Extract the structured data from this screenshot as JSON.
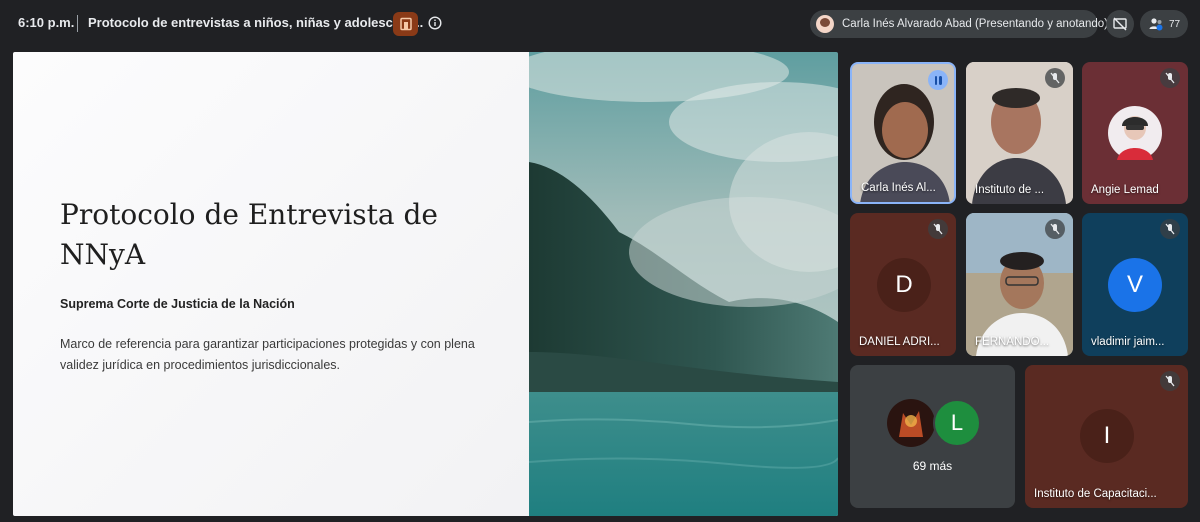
{
  "topbar": {
    "time": "6:10 p.m.",
    "meeting_title": "Protocolo de entrevistas a niños, niñas y adolescent...",
    "presenter_label": "Carla Inés Alvarado Abad (Presentando y anotando)",
    "participant_count": "77",
    "icons": {
      "host": "host-controls-icon",
      "info": "info-icon",
      "stop_presenting": "presentation-off-icon",
      "people": "people-icon"
    }
  },
  "slide": {
    "title": "Protocolo de Entrevista de NNyA",
    "organization": "Suprema Corte de Justicia de la Nación",
    "description": "Marco de referencia para garantizar participaciones protegidas y con plena validez jurídica en procedimientos jurisdiccionales."
  },
  "tiles": [
    {
      "name": "Carla Inés Al...",
      "state": "speaking"
    },
    {
      "name": "Instituto de ...",
      "state": "muted"
    },
    {
      "name": "Angie Lemad",
      "state": "muted"
    },
    {
      "name": "DANIEL ADRI...",
      "state": "muted",
      "avatar_letter": "D"
    },
    {
      "name": "FERNANDO...",
      "state": "muted"
    },
    {
      "name": "vladimir jaim...",
      "state": "muted",
      "avatar_letter": "V"
    },
    {
      "name": "69 más",
      "avatar_letter": "L"
    },
    {
      "name": "Instituto de Capacitaci...",
      "state": "muted",
      "avatar_letter": "I"
    }
  ],
  "colors": {
    "background": "#202124",
    "pill": "#3c4043",
    "speaking_border": "#8ab4f8",
    "avatar_v": "#1a73e8",
    "avatar_l": "#1e8e3e"
  }
}
